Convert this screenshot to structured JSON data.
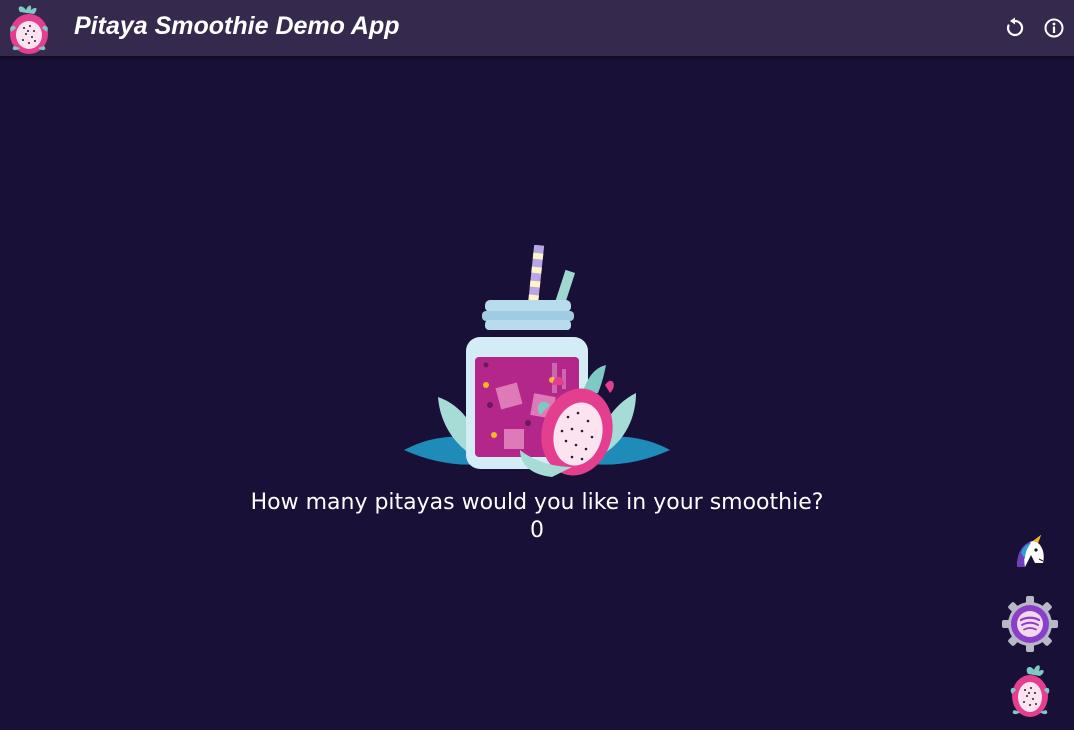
{
  "header": {
    "title": "Pitaya Smoothie Demo App",
    "logo_icon": "dragon-fruit-icon",
    "actions": [
      {
        "icon": "reset-icon",
        "interactable": true
      },
      {
        "icon": "info-icon",
        "interactable": true
      }
    ]
  },
  "main": {
    "illustration_icon": "smoothie-jar-icon",
    "question": "How many pitayas would you like in your smoothie?",
    "count": "0"
  },
  "floating_buttons": [
    {
      "icon": "unicorn-icon"
    },
    {
      "icon": "spotify-gear-icon"
    },
    {
      "icon": "dragon-fruit-icon"
    }
  ],
  "colors": {
    "background": "#181036",
    "topbar": "#352a4d",
    "text": "#ffffff",
    "pitaya_pink": "#e43f8e",
    "smoothie_purple": "#b4278a",
    "leaf_teal": "#7fc9c4"
  }
}
